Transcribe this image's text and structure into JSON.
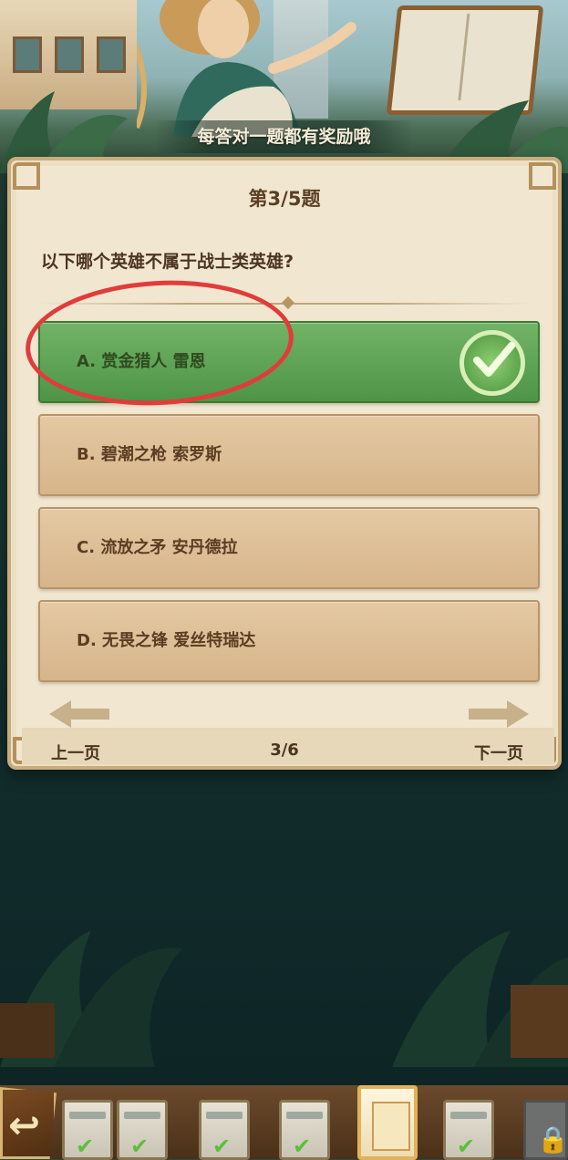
{
  "banner": {
    "text": "每答对一题都有奖励哦"
  },
  "quiz": {
    "counter": "第3/5题",
    "question": "以下哪个英雄不属于战士类英雄?",
    "options": [
      {
        "label": "A. 赏金猎人 雷恩",
        "state": "correct"
      },
      {
        "label": "B. 碧潮之枪 索罗斯",
        "state": "normal"
      },
      {
        "label": "C. 流放之矛 安丹德拉",
        "state": "normal"
      },
      {
        "label": "D. 无畏之锋 爱丝特瑞达",
        "state": "normal"
      }
    ],
    "nav": {
      "prev_label": "上一页",
      "page": "3/6",
      "next_label": "下一页"
    }
  },
  "tray": {
    "back_icon": "back-arrow-icon",
    "cards": [
      {
        "state": "completed"
      },
      {
        "state": "completed"
      },
      {
        "state": "completed"
      },
      {
        "state": "completed"
      },
      {
        "state": "current"
      },
      {
        "state": "completed"
      },
      {
        "state": "locked"
      }
    ]
  },
  "colors": {
    "correct_green": "#5ea54d",
    "highlight_circle": "#e23b3b",
    "panel_bg": "#f1e7d1",
    "option_bg": "#d7b58a"
  }
}
